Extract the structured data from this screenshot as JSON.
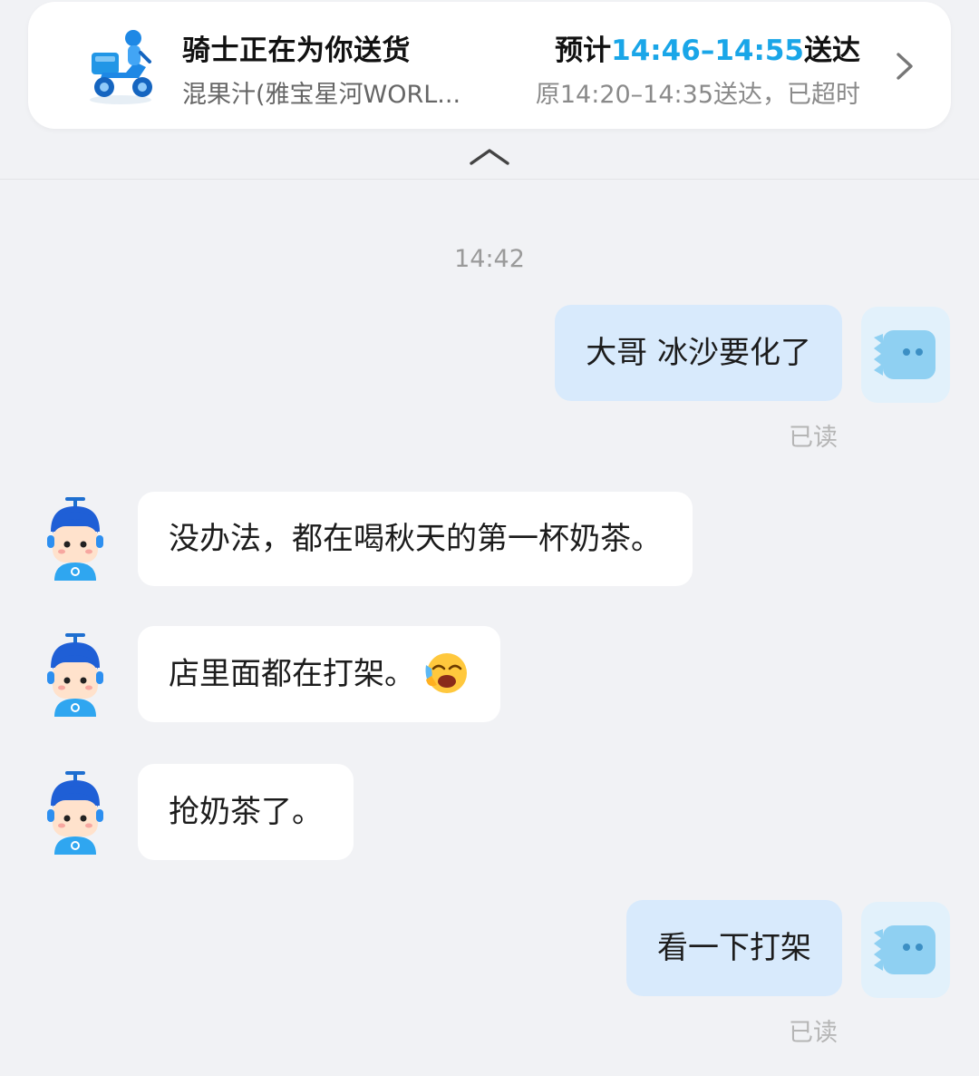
{
  "delivery": {
    "title": "骑士正在为你送货",
    "shop": "混果汁(雅宝星河WORL...",
    "eta_prefix": "预计",
    "eta_time": "14:46–14:55",
    "eta_suffix": "送达",
    "original": "原14:20–14:35送达，已超时",
    "accent_color": "#1aa6e8",
    "icon": "delivery-scooter-icon"
  },
  "chat": {
    "timestamp": "14:42",
    "messages": [
      {
        "from": "me",
        "text": "大哥 冰沙要化了",
        "status": "已读"
      },
      {
        "from": "rider",
        "text": "没办法，都在喝秋天的第一杯奶茶。"
      },
      {
        "from": "rider",
        "text": "店里面都在打架。",
        "emoji": "crying-face-emoji"
      },
      {
        "from": "rider",
        "text": "抢奶茶了。"
      },
      {
        "from": "me",
        "text": "看一下打架",
        "status": "已读"
      }
    ]
  },
  "colors": {
    "background": "#f1f2f5",
    "outgoing_bubble": "#d8eafc",
    "incoming_bubble": "#ffffff"
  }
}
